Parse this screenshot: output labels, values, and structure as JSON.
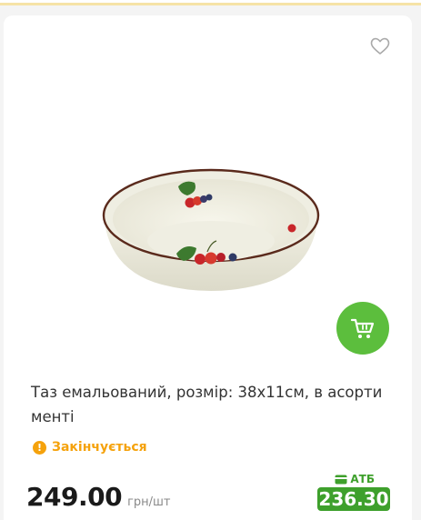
{
  "product": {
    "image_alt": "enamel basin with fruit pattern",
    "title": "Таз емальований, розмір: 38х11см, в асорти менті",
    "stock_status": "Закінчується",
    "price": "249.00",
    "price_unit": "грн/шт",
    "loyalty_label": "АТБ",
    "loyalty_price": "236.30",
    "icons": {
      "favorite": "heart-icon",
      "cart": "cart-icon",
      "stock": "warning-icon",
      "loyalty": "card-icon"
    }
  },
  "colors": {
    "accent_green": "#5cbe3d",
    "loyalty_green": "#3ea02c",
    "warning_orange": "#f5a20c"
  }
}
